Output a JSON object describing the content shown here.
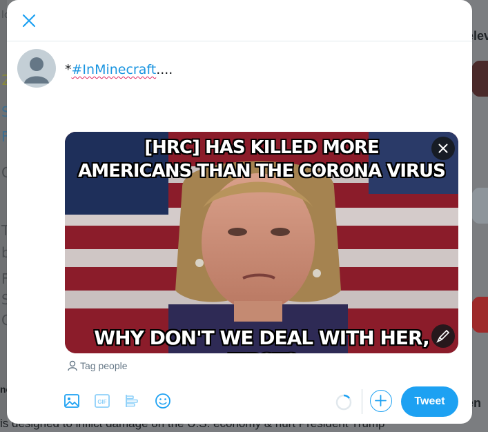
{
  "background": {
    "left_fragments": [
      "lc",
      "2",
      "S",
      "F",
      "C",
      "T",
      "b",
      "F",
      "S",
      "C"
    ],
    "right_heading": "elev",
    "right_section_label": "en",
    "bottom_label": "ne",
    "bottom_text": "is designed to inflict damage on the U.S. economy & hurt President Trump"
  },
  "compose": {
    "prefix": "*",
    "hashtag": "#InMinecraft",
    "suffix": "....",
    "tag_people_label": "Tag people",
    "tweet_button_label": "Tweet"
  },
  "media": {
    "caption_top_line1": "[HRC] HAS KILLED MORE",
    "caption_top_line2": "AMERICANS THAN THE CORONA VIRUS",
    "caption_bottom": "WHY DON'T WE DEAL WITH HER, FIRST?"
  },
  "colors": {
    "accent": "#1da1f2",
    "hashtag": "#1b95e0",
    "muted": "#657786"
  },
  "icons": {
    "close": "close-icon",
    "image": "image-icon",
    "gif": "gif-icon",
    "poll": "poll-icon",
    "emoji": "emoji-icon",
    "add": "plus-icon",
    "edit": "brush-icon",
    "person": "person-icon"
  }
}
